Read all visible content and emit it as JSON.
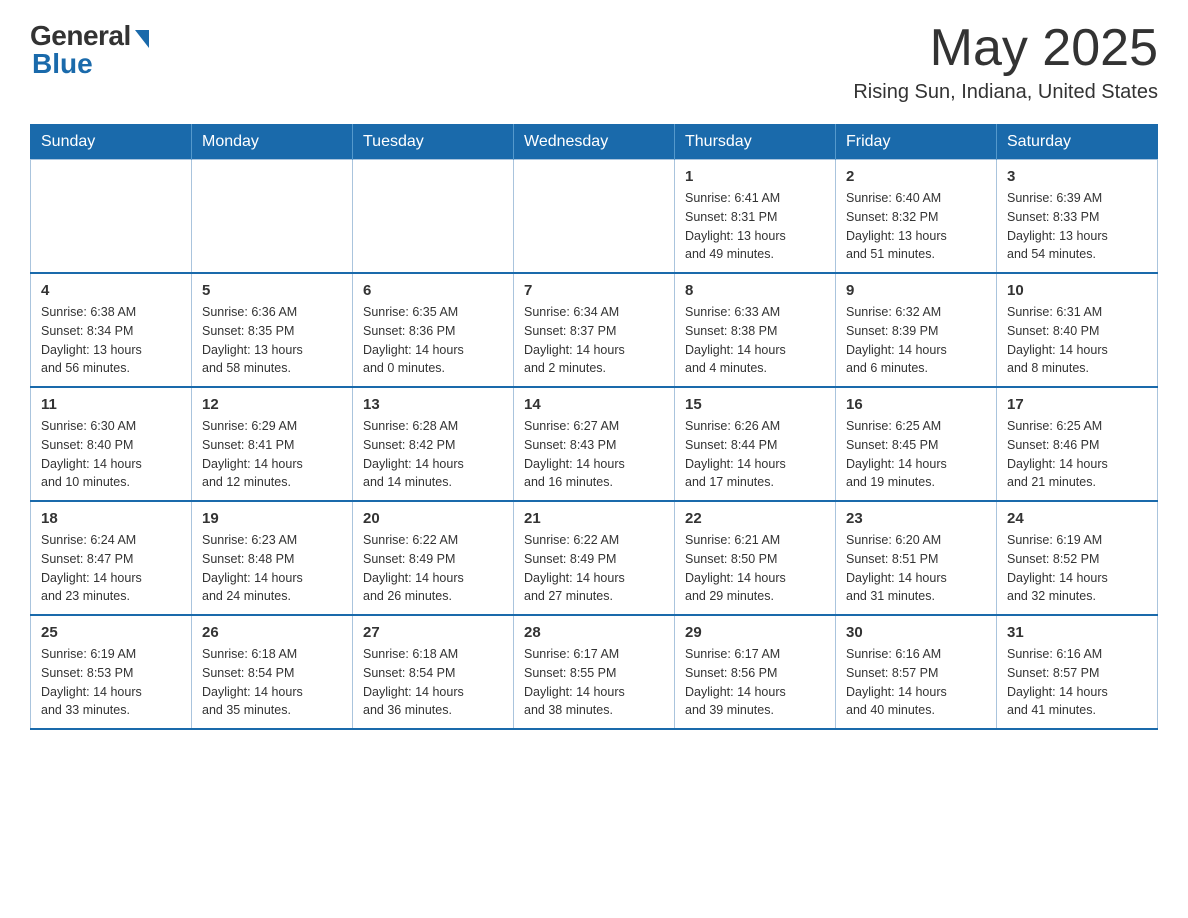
{
  "header": {
    "logo_general": "General",
    "logo_blue": "Blue",
    "month_year": "May 2025",
    "location": "Rising Sun, Indiana, United States"
  },
  "days_of_week": [
    "Sunday",
    "Monday",
    "Tuesday",
    "Wednesday",
    "Thursday",
    "Friday",
    "Saturday"
  ],
  "weeks": [
    [
      {
        "day": "",
        "info": ""
      },
      {
        "day": "",
        "info": ""
      },
      {
        "day": "",
        "info": ""
      },
      {
        "day": "",
        "info": ""
      },
      {
        "day": "1",
        "info": "Sunrise: 6:41 AM\nSunset: 8:31 PM\nDaylight: 13 hours\nand 49 minutes."
      },
      {
        "day": "2",
        "info": "Sunrise: 6:40 AM\nSunset: 8:32 PM\nDaylight: 13 hours\nand 51 minutes."
      },
      {
        "day": "3",
        "info": "Sunrise: 6:39 AM\nSunset: 8:33 PM\nDaylight: 13 hours\nand 54 minutes."
      }
    ],
    [
      {
        "day": "4",
        "info": "Sunrise: 6:38 AM\nSunset: 8:34 PM\nDaylight: 13 hours\nand 56 minutes."
      },
      {
        "day": "5",
        "info": "Sunrise: 6:36 AM\nSunset: 8:35 PM\nDaylight: 13 hours\nand 58 minutes."
      },
      {
        "day": "6",
        "info": "Sunrise: 6:35 AM\nSunset: 8:36 PM\nDaylight: 14 hours\nand 0 minutes."
      },
      {
        "day": "7",
        "info": "Sunrise: 6:34 AM\nSunset: 8:37 PM\nDaylight: 14 hours\nand 2 minutes."
      },
      {
        "day": "8",
        "info": "Sunrise: 6:33 AM\nSunset: 8:38 PM\nDaylight: 14 hours\nand 4 minutes."
      },
      {
        "day": "9",
        "info": "Sunrise: 6:32 AM\nSunset: 8:39 PM\nDaylight: 14 hours\nand 6 minutes."
      },
      {
        "day": "10",
        "info": "Sunrise: 6:31 AM\nSunset: 8:40 PM\nDaylight: 14 hours\nand 8 minutes."
      }
    ],
    [
      {
        "day": "11",
        "info": "Sunrise: 6:30 AM\nSunset: 8:40 PM\nDaylight: 14 hours\nand 10 minutes."
      },
      {
        "day": "12",
        "info": "Sunrise: 6:29 AM\nSunset: 8:41 PM\nDaylight: 14 hours\nand 12 minutes."
      },
      {
        "day": "13",
        "info": "Sunrise: 6:28 AM\nSunset: 8:42 PM\nDaylight: 14 hours\nand 14 minutes."
      },
      {
        "day": "14",
        "info": "Sunrise: 6:27 AM\nSunset: 8:43 PM\nDaylight: 14 hours\nand 16 minutes."
      },
      {
        "day": "15",
        "info": "Sunrise: 6:26 AM\nSunset: 8:44 PM\nDaylight: 14 hours\nand 17 minutes."
      },
      {
        "day": "16",
        "info": "Sunrise: 6:25 AM\nSunset: 8:45 PM\nDaylight: 14 hours\nand 19 minutes."
      },
      {
        "day": "17",
        "info": "Sunrise: 6:25 AM\nSunset: 8:46 PM\nDaylight: 14 hours\nand 21 minutes."
      }
    ],
    [
      {
        "day": "18",
        "info": "Sunrise: 6:24 AM\nSunset: 8:47 PM\nDaylight: 14 hours\nand 23 minutes."
      },
      {
        "day": "19",
        "info": "Sunrise: 6:23 AM\nSunset: 8:48 PM\nDaylight: 14 hours\nand 24 minutes."
      },
      {
        "day": "20",
        "info": "Sunrise: 6:22 AM\nSunset: 8:49 PM\nDaylight: 14 hours\nand 26 minutes."
      },
      {
        "day": "21",
        "info": "Sunrise: 6:22 AM\nSunset: 8:49 PM\nDaylight: 14 hours\nand 27 minutes."
      },
      {
        "day": "22",
        "info": "Sunrise: 6:21 AM\nSunset: 8:50 PM\nDaylight: 14 hours\nand 29 minutes."
      },
      {
        "day": "23",
        "info": "Sunrise: 6:20 AM\nSunset: 8:51 PM\nDaylight: 14 hours\nand 31 minutes."
      },
      {
        "day": "24",
        "info": "Sunrise: 6:19 AM\nSunset: 8:52 PM\nDaylight: 14 hours\nand 32 minutes."
      }
    ],
    [
      {
        "day": "25",
        "info": "Sunrise: 6:19 AM\nSunset: 8:53 PM\nDaylight: 14 hours\nand 33 minutes."
      },
      {
        "day": "26",
        "info": "Sunrise: 6:18 AM\nSunset: 8:54 PM\nDaylight: 14 hours\nand 35 minutes."
      },
      {
        "day": "27",
        "info": "Sunrise: 6:18 AM\nSunset: 8:54 PM\nDaylight: 14 hours\nand 36 minutes."
      },
      {
        "day": "28",
        "info": "Sunrise: 6:17 AM\nSunset: 8:55 PM\nDaylight: 14 hours\nand 38 minutes."
      },
      {
        "day": "29",
        "info": "Sunrise: 6:17 AM\nSunset: 8:56 PM\nDaylight: 14 hours\nand 39 minutes."
      },
      {
        "day": "30",
        "info": "Sunrise: 6:16 AM\nSunset: 8:57 PM\nDaylight: 14 hours\nand 40 minutes."
      },
      {
        "day": "31",
        "info": "Sunrise: 6:16 AM\nSunset: 8:57 PM\nDaylight: 14 hours\nand 41 minutes."
      }
    ]
  ]
}
